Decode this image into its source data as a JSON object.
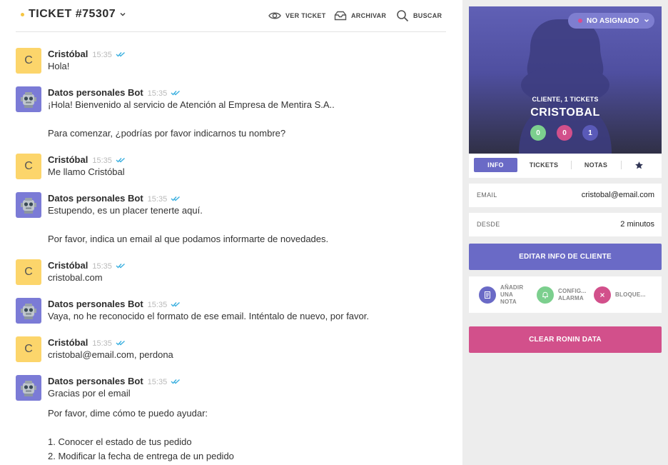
{
  "header": {
    "ticket_title": "TICKET #75307",
    "view_ticket": "VER TICKET",
    "archive": "ARCHIVAR",
    "search": "BUSCAR"
  },
  "colors": {
    "accent": "#6a6ac6",
    "pink": "#d2508b",
    "green": "#7ccf8e",
    "check": "#3bb0e0",
    "avatar_user": "#fcd56b",
    "avatar_bot": "#7b7bd6"
  },
  "messages": [
    {
      "author": "Cristóbal",
      "avatar": "C",
      "time": "15:35",
      "lines": [
        "Hola!"
      ]
    },
    {
      "author": "Datos personales Bot",
      "avatar": "robot-icon",
      "time": "15:35",
      "lines": [
        "¡Hola! Bienvenido al servicio de Atención al Empresa de Mentira S.A..",
        "Para comenzar, ¿podrías por favor indicarnos tu nombre?"
      ]
    },
    {
      "author": "Cristóbal",
      "avatar": "C",
      "time": "15:35",
      "lines": [
        "Me llamo Cristóbal"
      ]
    },
    {
      "author": "Datos personales Bot",
      "avatar": "robot-icon",
      "time": "15:35",
      "lines": [
        "Estupendo, es un placer tenerte aquí.",
        "Por favor, indica un email al que podamos informarte de novedades."
      ]
    },
    {
      "author": "Cristóbal",
      "avatar": "C",
      "time": "15:35",
      "lines": [
        "cristobal.com"
      ]
    },
    {
      "author": "Datos personales Bot",
      "avatar": "robot-icon",
      "time": "15:35",
      "lines": [
        "Vaya, no he reconocido el formato de ese email. Inténtalo de nuevo, por favor."
      ]
    },
    {
      "author": "Cristóbal",
      "avatar": "C",
      "time": "15:35",
      "lines": [
        "cristobal@email.com, perdona"
      ]
    },
    {
      "author": "Datos personales Bot",
      "avatar": "robot-icon",
      "time": "15:35",
      "lines": [
        "Gracias por el email",
        "Por favor, dime cómo te puedo ayudar:",
        "1. Conocer el estado de tus pedido",
        "2. Modificar la fecha de entrega de un pedido"
      ]
    }
  ],
  "sidebar": {
    "assign_label": "NO ASIGNADO",
    "customer_subtitle": "CLIENTE, 1 TICKETS",
    "customer_name": "CRISTOBAL",
    "stats": [
      "0",
      "0",
      "1"
    ],
    "tabs": [
      "INFO",
      "TICKETS",
      "NOTAS"
    ],
    "tab_star": "star-icon",
    "email_label": "EMAIL",
    "email_value": "cristobal@email.com",
    "since_label": "DESDE",
    "since_value": "2 minutos",
    "edit_button": "EDITAR INFO DE CLIENTE",
    "actions": [
      {
        "icon": "note-icon",
        "label_lines": [
          "AÑADIR",
          "UNA",
          "NOTA"
        ]
      },
      {
        "icon": "bell-icon",
        "label_lines": [
          "CONFIG...",
          "ALARMA"
        ]
      },
      {
        "icon": "close-icon",
        "label_lines": [
          "BLOQUE..."
        ]
      }
    ],
    "clear_button": "CLEAR RONIN DATA"
  }
}
